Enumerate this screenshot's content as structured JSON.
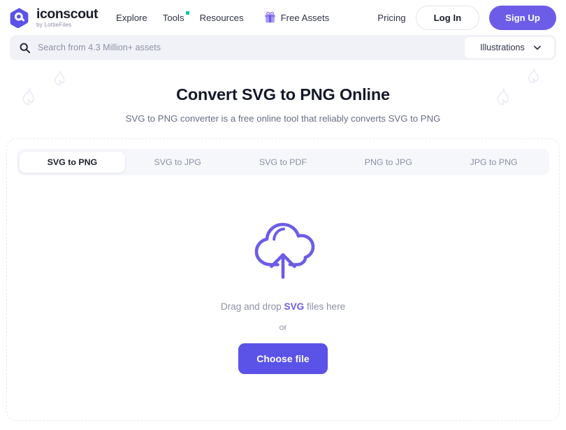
{
  "header": {
    "logo": {
      "mark_name": "iconscout-hexagon-logo-icon",
      "word": "iconscout",
      "sub": "by LottieFiles"
    },
    "nav": [
      {
        "label": "Explore",
        "name": "nav-link-explore",
        "dot": false
      },
      {
        "label": "Tools",
        "name": "nav-link-tools",
        "dot": true
      },
      {
        "label": "Resources",
        "name": "nav-link-resources",
        "dot": false
      }
    ],
    "free_assets": {
      "label": "Free Assets",
      "icon": "gift-icon"
    },
    "pricing_label": "Pricing",
    "login_label": "Log In",
    "signup_label": "Sign Up"
  },
  "search": {
    "icon": "search-icon",
    "placeholder": "Search from 4.3 Million+ assets",
    "value": "",
    "category_selected": "Illustrations",
    "chevron_icon": "chevron-down-icon"
  },
  "hero": {
    "title": "Convert SVG to PNG Online",
    "subtitle": "SVG to PNG converter is a free online tool that reliably converts SVG to PNG",
    "decorations": [
      "flame-icon",
      "flame-icon",
      "flame-icon",
      "flame-icon"
    ]
  },
  "converter": {
    "tabs": [
      {
        "label": "SVG to PNG",
        "active": true
      },
      {
        "label": "SVG to JPG",
        "active": false
      },
      {
        "label": "SVG to PDF",
        "active": false
      },
      {
        "label": "PNG to JPG",
        "active": false
      },
      {
        "label": "JPG to PNG",
        "active": false
      }
    ],
    "dropzone": {
      "icon": "cloud-upload-icon",
      "text_before": "Drag and drop ",
      "text_highlight": "SVG",
      "text_after": " files here",
      "or_label": "or",
      "button_label": "Choose file"
    }
  },
  "colors": {
    "brand_purple": "#6c5ce7",
    "button_purple": "#5b52e8",
    "accent_teal": "#00c4a7",
    "text_dark": "#15182a",
    "text_muted": "#8d91a6",
    "search_bg": "#f1f2f7",
    "tabs_bg": "#f6f7fb",
    "card_border": "#e7e9f1"
  }
}
